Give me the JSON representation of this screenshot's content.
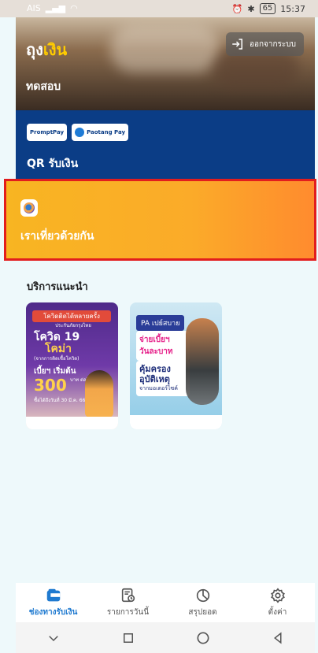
{
  "status_bar": {
    "carrier": "AIS",
    "time": "15:37",
    "battery": "65"
  },
  "header": {
    "brand_white": "ถุง",
    "brand_yellow": "เงิน",
    "logout_label": "ออกจากระบบ",
    "tagline": "ทดสอบ"
  },
  "qr_card": {
    "title": "QR รับเงิน",
    "promptpay_label": "PromptPay",
    "paotang_label": "Paotang Pay"
  },
  "rao_card": {
    "title": "เราเที่ยวด้วยกัน"
  },
  "recommended": {
    "title": "บริการแนะนำ",
    "banners": [
      {
        "headline": "โควิดติดได้หลายครั้ง",
        "sub": "ประกันภัยกรุงไทย",
        "product1": "โควิด 19",
        "product2": "โคม่า",
        "note": "(จากการติดเชื้อโควิด)",
        "price_label": "เบี้ยฯ เริ่มต้น",
        "price": "300",
        "price_unit": "บาท ต่อปี",
        "deadline": "ซื้อได้ถึงวันที่ 30 มี.ค. 66"
      },
      {
        "tag": "PA เปย์สบาย",
        "line1": "จ่ายเบี้ยฯ",
        "line2": "วันละบาท",
        "line3": "คุ้มครอง",
        "line4": "อุบัติเหตุ",
        "line5": "จากมอเตอร์ไซค์"
      }
    ]
  },
  "tabbar": {
    "items": [
      {
        "label": "ช่องทางรับเงิน",
        "icon": "wallet-icon",
        "active": true
      },
      {
        "label": "รายการวันนี้",
        "icon": "receipt-clock-icon",
        "active": false
      },
      {
        "label": "สรุปยอด",
        "icon": "pie-chart-icon",
        "active": false
      },
      {
        "label": "ตั้งค่า",
        "icon": "gear-icon",
        "active": false
      }
    ]
  },
  "colors": {
    "accent_blue": "#1f7ad0",
    "brand_yellow": "#ffcc00",
    "qr_bg": "#0b3d86",
    "rao_orange": "#fbab29",
    "highlight_red": "#e21d1d"
  }
}
